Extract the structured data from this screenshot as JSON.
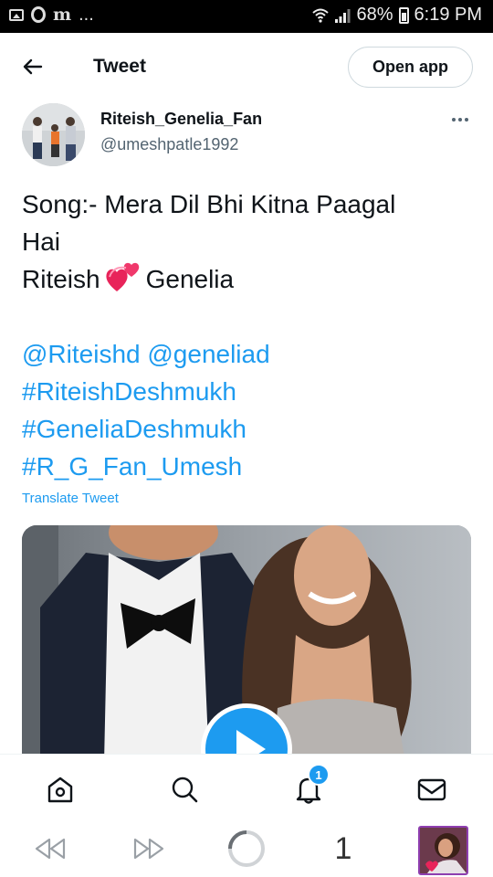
{
  "status_bar": {
    "notification_dots": "...",
    "battery_percent": "68%",
    "time": "6:19 PM",
    "icons": [
      "gallery-icon",
      "opera-icon",
      "m-app-icon",
      "wifi-icon",
      "signal-icon",
      "battery-icon"
    ]
  },
  "header": {
    "title": "Tweet",
    "open_app_label": "Open app",
    "back_icon": "arrow-left-icon"
  },
  "tweet": {
    "author_name": "Riteish_Genelia_Fan",
    "author_handle": "@umeshpatle1992",
    "more_icon": "more-horizontal-icon",
    "text_line_1": "Song:- Mera Dil Bhi Kitna Paagal",
    "text_line_2": "Hai",
    "text_line_3a": "Riteish",
    "text_line_3b": "Genelia",
    "emoji": "revolving-hearts-icon",
    "mention_1": "@Riteishd",
    "mention_2": "@geneliad",
    "hashtag_1": "#RiteishDeshmukh",
    "hashtag_2": "#GeneliaDeshmukh",
    "hashtag_3": "#R_G_Fan_Umesh",
    "translate_label": "Translate Tweet",
    "media_play_icon": "play-icon"
  },
  "bottom_nav": {
    "items": [
      "home-icon",
      "search-icon",
      "notifications-icon",
      "messages-icon"
    ],
    "notification_badge": "1"
  },
  "browser_bar": {
    "back_icon": "rewind-icon",
    "forward_icon": "fast-forward-icon",
    "loading_icon": "loading-spinner-icon",
    "tab_count": "1"
  },
  "colors": {
    "accent": "#1d9bf0",
    "text": "#0f1419",
    "secondary_text": "#536471"
  }
}
